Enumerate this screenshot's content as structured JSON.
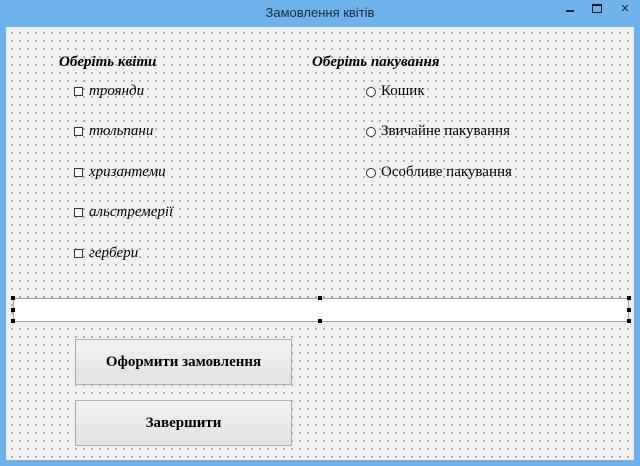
{
  "window": {
    "title": "Замовлення квітів",
    "controls": {
      "minimize_icon": "minimize-icon",
      "maximize_icon": "maximize-icon",
      "close_icon": "close-icon"
    }
  },
  "flowers": {
    "heading": "Оберіть квіти",
    "items": [
      {
        "label": "троянди",
        "checked": false
      },
      {
        "label": "тюльпани",
        "checked": false
      },
      {
        "label": "хризантеми",
        "checked": false
      },
      {
        "label": "альстремерії",
        "checked": false
      },
      {
        "label": "гербери",
        "checked": false
      }
    ]
  },
  "packaging": {
    "heading": "Оберіть пакування",
    "options": [
      {
        "label": "Кошик",
        "selected": false
      },
      {
        "label": "Звичайне пакування",
        "selected": false
      },
      {
        "label": "Особливе пакування",
        "selected": false
      }
    ]
  },
  "order_field": {
    "value": ""
  },
  "buttons": {
    "order": "Оформити замовлення",
    "finish": "Завершити"
  }
}
